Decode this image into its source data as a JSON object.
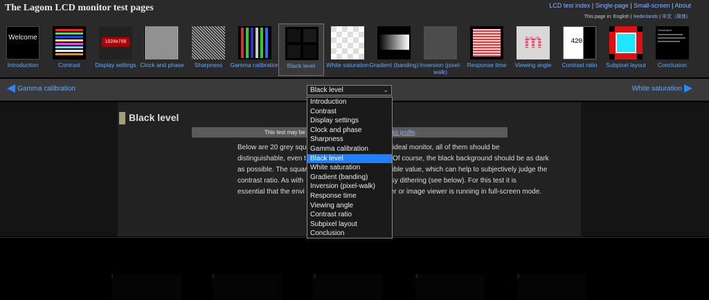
{
  "header": {
    "site_title": "The Lagom LCD monitor test pages",
    "links": [
      "LCD test index",
      "Single-page",
      "Small-screen",
      "About"
    ],
    "lang_prefix": "This page in: English |",
    "lang_links": [
      "Nederlands",
      "中文（简体）"
    ]
  },
  "thumbnails": [
    {
      "label": "Introduction",
      "caption": "Welcome"
    },
    {
      "label": "Contrast"
    },
    {
      "label": "Display settings",
      "caption": "1024x768"
    },
    {
      "label": "Clock and phase"
    },
    {
      "label": "Sharpness"
    },
    {
      "label": "Gamma calibration"
    },
    {
      "label": "Black level"
    },
    {
      "label": "White saturation"
    },
    {
      "label": "Gradient (banding)"
    },
    {
      "label": "Inversion (pixel-walk)"
    },
    {
      "label": "Response time"
    },
    {
      "label": "Viewing angle",
      "caption": "m"
    },
    {
      "label": "Contrast ratio",
      "caption": "420:1"
    },
    {
      "label": "Subpixel layout"
    },
    {
      "label": "Conclusion",
      "caption": "Conclusion"
    }
  ],
  "nav": {
    "prev_label": "Gamma calibration",
    "next_label": "White saturation",
    "select_value": "Black level"
  },
  "dropdown_options": [
    "Introduction",
    "Contrast",
    "Display settings",
    "Clock and phase",
    "Sharpness",
    "Gamma calibration",
    "Black level",
    "White saturation",
    "Gradient (banding)",
    "Inversion (pixel-walk)",
    "Response time",
    "Viewing angle",
    "Contrast ratio",
    "Subpixel layout",
    "Conclusion"
  ],
  "selected_option": "Black level",
  "content": {
    "title": "Black level",
    "notice_text": "This test may be",
    "notice_link": "m color profile",
    "notice_end": ".",
    "lines": [
      "Below are 20 grey squ                                  On an ideal monitor, all of them should be",
      "distinguishable, even t                                quares. Of course, the black background should be as dark",
      "as possible. The squar                                 st possible value, which can help to subjectively judge the",
      "contrast ratio. As with                                t see noisy dithering (see below). For this test it is",
      "essential that the envi                                e browser or image viewer is running in full-screen mode."
    ]
  },
  "squares": [
    "1",
    "2",
    "3",
    "4",
    "5"
  ],
  "colors": {
    "link": "#66aaff",
    "selection": "#1e7fff",
    "nav_arrow": "#2a86ff",
    "header_bg": "#2a2a2a"
  }
}
